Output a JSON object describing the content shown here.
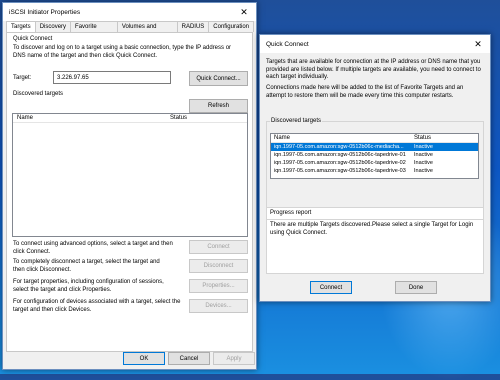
{
  "left": {
    "title": "iSCSI Initiator Properties",
    "tabs": [
      "Targets",
      "Discovery",
      "Favorite Targets",
      "Volumes and Devices",
      "RADIUS",
      "Configuration"
    ],
    "quick_connect_label": "Quick Connect",
    "quick_connect_desc": "To discover and log on to a target using a basic connection, type the IP address or DNS name of the target and then click Quick Connect.",
    "target_label": "Target:",
    "target_value": "3.226.97.65",
    "quick_connect_button": "Quick Connect...",
    "discovered_label": "Discovered targets",
    "refresh_button": "Refresh",
    "col_name": "Name",
    "col_status": "Status",
    "help_connect": "To connect using advanced options, select a target and then click Connect.",
    "connect_button": "Connect",
    "help_disconnect": "To completely disconnect a target, select the target and then click Disconnect.",
    "disconnect_button": "Disconnect",
    "help_properties": "For target properties, including configuration of sessions, select the target and click Properties.",
    "properties_button": "Properties...",
    "help_devices": "For configuration of devices associated with a target, select the target and then click Devices.",
    "devices_button": "Devices...",
    "ok_button": "OK",
    "cancel_button": "Cancel",
    "apply_button": "Apply"
  },
  "right": {
    "title": "Quick Connect",
    "intro": "Targets that are available for connection at the IP address or DNS name that you provided are listed below.  If multiple targets are available, you need to connect to each target individually.",
    "intro2": "Connections made here will be added to the list of Favorite Targets and an attempt to restore them will be made every time this computer restarts.",
    "discovered_label": "Discovered targets",
    "col_name": "Name",
    "col_status": "Status",
    "rows": [
      {
        "name": "iqn.1997-05.com.amazon:sgw-0512b06c-mediacha...",
        "status": "Inactive",
        "selected": true
      },
      {
        "name": "iqn.1997-05.com.amazon:sgw-0512b06c-tapedrive-01",
        "status": "Inactive",
        "selected": false
      },
      {
        "name": "iqn.1997-05.com.amazon:sgw-0512b06c-tapedrive-02",
        "status": "Inactive",
        "selected": false
      },
      {
        "name": "iqn.1997-05.com.amazon:sgw-0512b06c-tapedrive-03",
        "status": "Inactive",
        "selected": false
      }
    ],
    "progress_label": "Progress report",
    "progress_text": "There are multiple Targets discovered.Please select a single Target for Login using Quick Connect.",
    "connect_button": "Connect",
    "done_button": "Done"
  },
  "colors": {
    "selection": "#0078d7",
    "desktop": "#0e57c4"
  }
}
